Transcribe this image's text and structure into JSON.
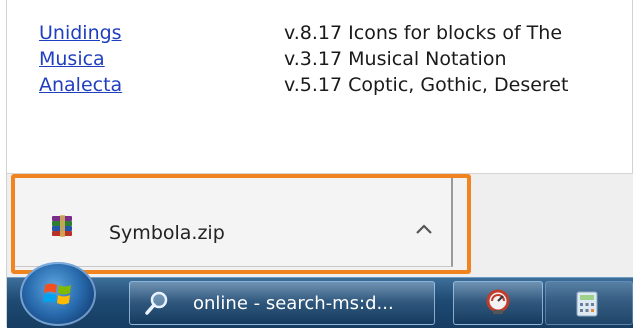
{
  "font_list": [
    {
      "name": "Unidings",
      "description": "v.8.17  Icons for blocks of The"
    },
    {
      "name": "Musica",
      "description": "v.3.17  Musical Notation"
    },
    {
      "name": "Analecta",
      "description": "v.5.17  Coptic, Gothic, Deseret"
    }
  ],
  "download_shelf": {
    "file_name": "Symbola.zip",
    "file_icon": "winrar-archive-icon",
    "menu_icon": "chevron-up-icon"
  },
  "taskbar": {
    "start_icon": "windows-start-orb",
    "search_window_label": "online - search-ms:d...",
    "search_icon": "search-magnifier-icon",
    "app2_icon": "app-gauge-icon",
    "app3_icon": "calculator-icon"
  },
  "colors": {
    "highlight_border": "#f0841e",
    "link": "#1f3fbf",
    "taskbar": "#1e4a73"
  }
}
